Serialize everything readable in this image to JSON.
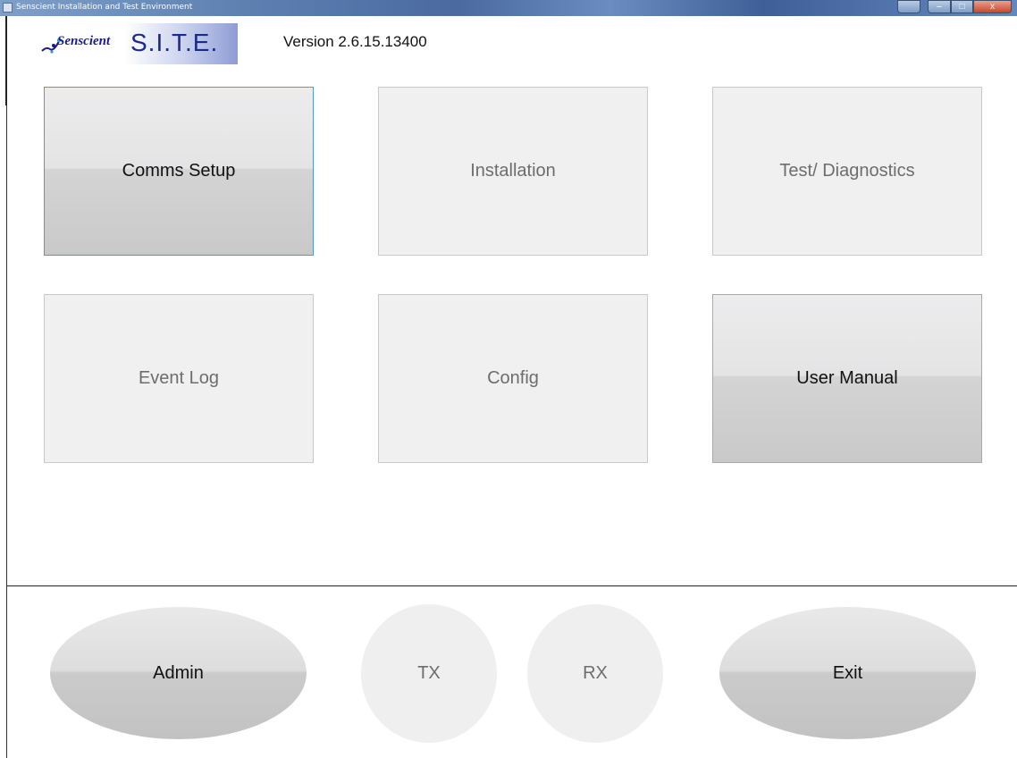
{
  "window": {
    "title": "Senscient Installation and Test Environment",
    "minimize_glyph": "–",
    "maximize_glyph": "□",
    "close_glyph": "x"
  },
  "header": {
    "brand": "Senscient",
    "product": "S.I.T.E.",
    "version": "Version 2.6.15.13400"
  },
  "tiles": [
    {
      "label": "Comms Setup",
      "state": "enabled"
    },
    {
      "label": "Installation",
      "state": "disabled"
    },
    {
      "label": "Test/ Diagnostics",
      "state": "disabled"
    },
    {
      "label": "Event Log",
      "state": "disabled"
    },
    {
      "label": "Config",
      "state": "disabled"
    },
    {
      "label": "User Manual",
      "state": "enabled"
    }
  ],
  "footer": {
    "admin": "Admin",
    "tx": "TX",
    "rx": "RX",
    "exit": "Exit"
  },
  "colors": {
    "logo_blue": "#1a2a90",
    "focus_border": "#4e9ccf",
    "disabled_text": "#6d6d6d"
  }
}
